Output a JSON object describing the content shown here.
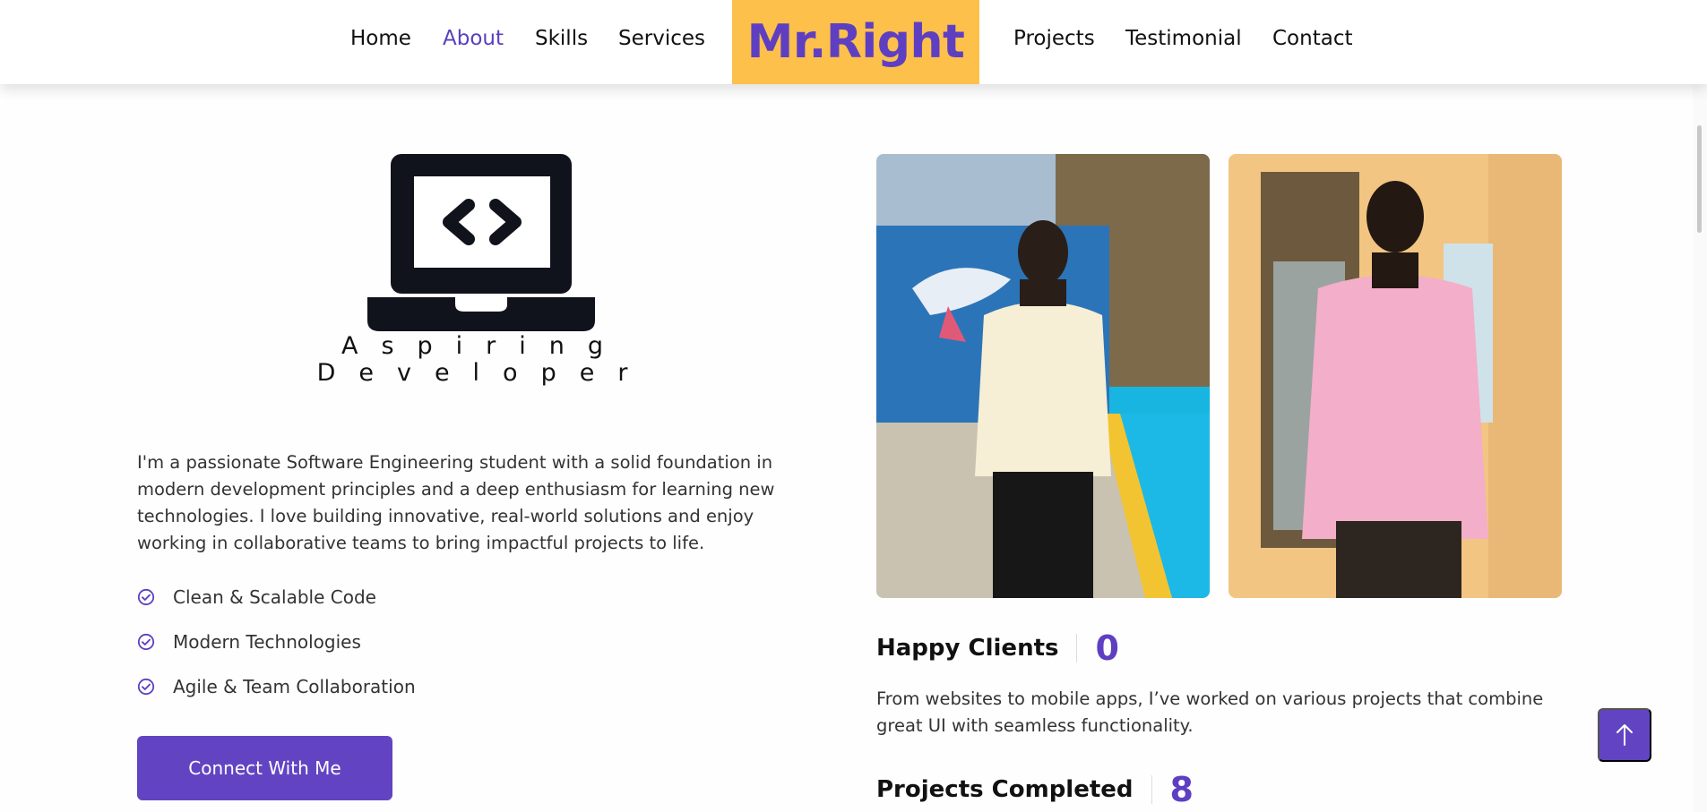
{
  "nav": {
    "left": [
      {
        "label": "Home",
        "active": false
      },
      {
        "label": "About",
        "active": true
      },
      {
        "label": "Skills",
        "active": false
      },
      {
        "label": "Services",
        "active": false
      }
    ],
    "right": [
      {
        "label": "Projects",
        "active": false
      },
      {
        "label": "Testimonial",
        "active": false
      },
      {
        "label": "Contact",
        "active": false
      }
    ],
    "brand": "Mr.Right"
  },
  "about": {
    "logo_icon": "laptop-code-icon",
    "tagline_line1": "Aspiring",
    "tagline_line2": "Developer",
    "intro": "I'm a passionate Software Engineering student with a solid foundation in modern development principles and a deep enthusiasm for learning new technologies. I love building innovative, real-world solutions and enjoy working in collaborative teams to bring impactful projects to life.",
    "features": [
      "Clean & Scalable Code",
      "Modern Technologies",
      "Agile & Team Collaboration"
    ],
    "cta_label": "Connect With Me"
  },
  "stats": [
    {
      "label": "Happy Clients",
      "value": "0",
      "description": "From websites to mobile apps, I’ve worked on various projects that combine great UI with seamless functionality."
    },
    {
      "label": "Projects Completed",
      "value": "8"
    }
  ],
  "photos": [
    "portrait-poolside-photo",
    "portrait-balcony-photo"
  ],
  "colors": {
    "accent": "#5e3fc2",
    "brand_bg": "#fcc04b",
    "button": "#6244c3"
  },
  "back_to_top_icon": "arrow-up-icon"
}
